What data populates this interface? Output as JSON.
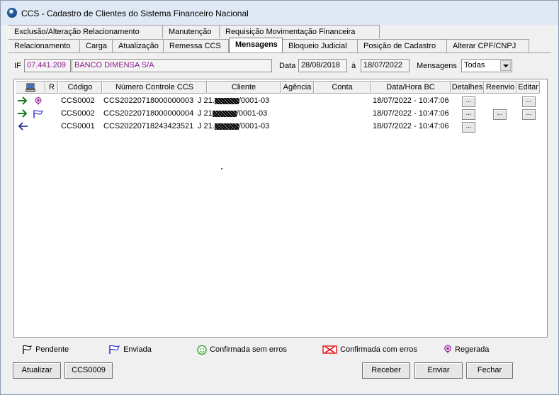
{
  "window": {
    "title": "CCS - Cadastro de Clientes do Sistema Financeiro Nacional"
  },
  "tabs_row1": [
    "Exclusão/Alteração Relacionamento",
    "Manutenção",
    "Requisição Movimentação Financeira"
  ],
  "tabs_row2": [
    "Relacionamento",
    "Carga",
    "Atualização",
    "Remessa CCS",
    "Mensagens",
    "Bloqueio Judicial",
    "Posição de Cadastro",
    "Alterar CPF/CNPJ"
  ],
  "active_tab": "Mensagens",
  "filters": {
    "if_label": "IF",
    "if_code": "07.441.209",
    "if_name": "BANCO DIMENSA S/A",
    "data_label": "Data",
    "date_from": "28/08/2018",
    "to_label": "à",
    "date_to": "18/07/2022",
    "mensagens_label": "Mensagens",
    "mensagens_value": "Todas"
  },
  "table": {
    "headers": [
      "R",
      "Código",
      "Número Controle CCS",
      "Cliente",
      "Agência",
      "Conta",
      "Data/Hora BC",
      "Detalhes",
      "Reenvio",
      "Editar"
    ],
    "rows": [
      {
        "direction": "right-arrow-icon",
        "status": "regerada-icon",
        "codigo": "CCS0002",
        "controle": "CCS20220718000000003",
        "cliente_prefix": "J  21.",
        "cliente_suffix": "/0001-03",
        "data_hora": "18/07/2022 - 10:47:06",
        "detalhes": "...",
        "reenvio": "",
        "editar": "..."
      },
      {
        "direction": "right-arrow-icon",
        "status": "enviada-flag-icon",
        "codigo": "CCS0002",
        "controle": "CCS20220718000000004",
        "cliente_prefix": "J  21",
        "cliente_suffix": "/0001-03",
        "data_hora": "18/07/2022 - 10:47:06",
        "detalhes": "...",
        "reenvio": "...",
        "editar": "..."
      },
      {
        "direction": "left-arrow-icon",
        "status": "",
        "codigo": "CCS0001",
        "controle": "CCS20220718243423521",
        "cliente_prefix": "J  21.",
        "cliente_suffix": "/0001-03",
        "data_hora": "18/07/2022 - 10:47:06",
        "detalhes": "...",
        "reenvio": "",
        "editar": ""
      }
    ]
  },
  "legend": {
    "pendente": "Pendente",
    "enviada": "Enviada",
    "confirmada_sem_erros": "Confirmada sem erros",
    "confirmada_com_erros": "Confirmada com erros",
    "regerada": "Regerada"
  },
  "buttons": {
    "atualizar": "Atualizar",
    "ccs0009": "CCS0009",
    "receber": "Receber",
    "enviar": "Enviar",
    "fechar": "Fechar"
  },
  "colors": {
    "arrow_right": "#1a7a1a",
    "arrow_left": "#1a1a9a",
    "flag_blue": "#1a1acc",
    "regerada": "#8b1a8b",
    "check_green": "#1a9a1a",
    "error_red": "#dd0000"
  }
}
